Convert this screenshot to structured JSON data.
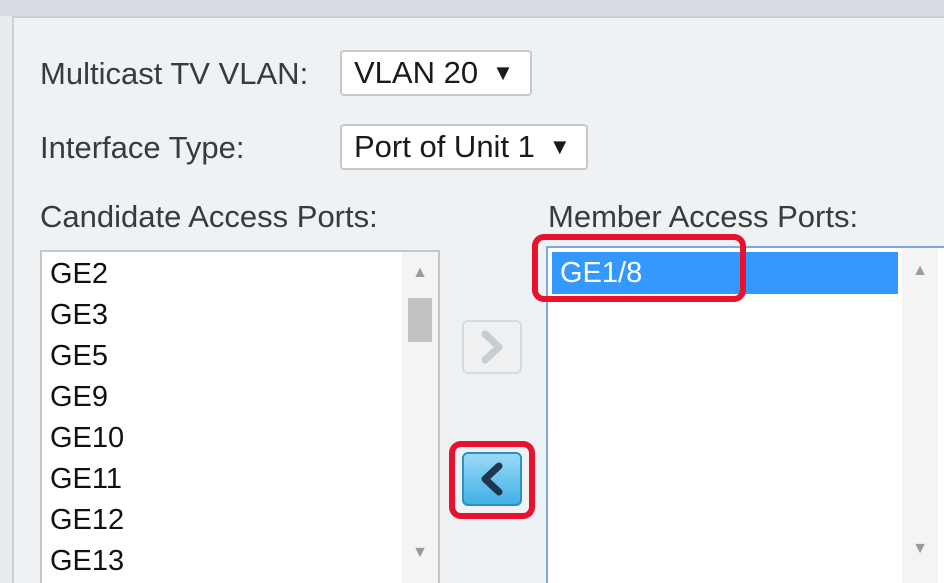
{
  "form": {
    "vlan_label": "Multicast TV VLAN:",
    "vlan_value": "VLAN 20",
    "interface_label": "Interface Type:",
    "interface_value": "Port of Unit 1",
    "caret": "▼"
  },
  "candidate": {
    "label": "Candidate Access Ports:",
    "items": [
      "GE2",
      "GE3",
      "GE5",
      "GE9",
      "GE10",
      "GE11",
      "GE12",
      "GE13"
    ]
  },
  "member": {
    "label": "Member Access Ports:",
    "items": [
      "GE1/8"
    ],
    "selected": "GE1/8"
  },
  "buttons": {
    "add_glyph": "›",
    "remove_glyph": "‹"
  },
  "scroll": {
    "up": "▲",
    "down": "▼"
  },
  "colors": {
    "highlight": "#e8122c",
    "selection": "#3399ff",
    "member_border": "#7ea6d9"
  }
}
